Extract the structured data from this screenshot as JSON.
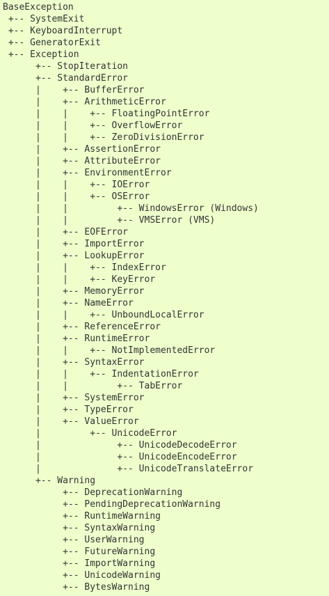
{
  "lines": [
    "BaseException",
    " +-- SystemExit",
    " +-- KeyboardInterrupt",
    " +-- GeneratorExit",
    " +-- Exception",
    "      +-- StopIteration",
    "      +-- StandardError",
    "      |    +-- BufferError",
    "      |    +-- ArithmeticError",
    "      |    |    +-- FloatingPointError",
    "      |    |    +-- OverflowError",
    "      |    |    +-- ZeroDivisionError",
    "      |    +-- AssertionError",
    "      |    +-- AttributeError",
    "      |    +-- EnvironmentError",
    "      |    |    +-- IOError",
    "      |    |    +-- OSError",
    "      |    |         +-- WindowsError (Windows)",
    "      |    |         +-- VMSError (VMS)",
    "      |    +-- EOFError",
    "      |    +-- ImportError",
    "      |    +-- LookupError",
    "      |    |    +-- IndexError",
    "      |    |    +-- KeyError",
    "      |    +-- MemoryError",
    "      |    +-- NameError",
    "      |    |    +-- UnboundLocalError",
    "      |    +-- ReferenceError",
    "      |    +-- RuntimeError",
    "      |    |    +-- NotImplementedError",
    "      |    +-- SyntaxError",
    "      |    |    +-- IndentationError",
    "      |    |         +-- TabError",
    "      |    +-- SystemError",
    "      |    +-- TypeError",
    "      |    +-- ValueError",
    "      |         +-- UnicodeError",
    "      |              +-- UnicodeDecodeError",
    "      |              +-- UnicodeEncodeError",
    "      |              +-- UnicodeTranslateError",
    "      +-- Warning",
    "           +-- DeprecationWarning",
    "           +-- PendingDeprecationWarning",
    "           +-- RuntimeWarning",
    "           +-- SyntaxWarning",
    "           +-- UserWarning",
    "           +-- FutureWarning",
    "           +-- ImportWarning",
    "           +-- UnicodeWarning",
    "           +-- BytesWarning"
  ]
}
